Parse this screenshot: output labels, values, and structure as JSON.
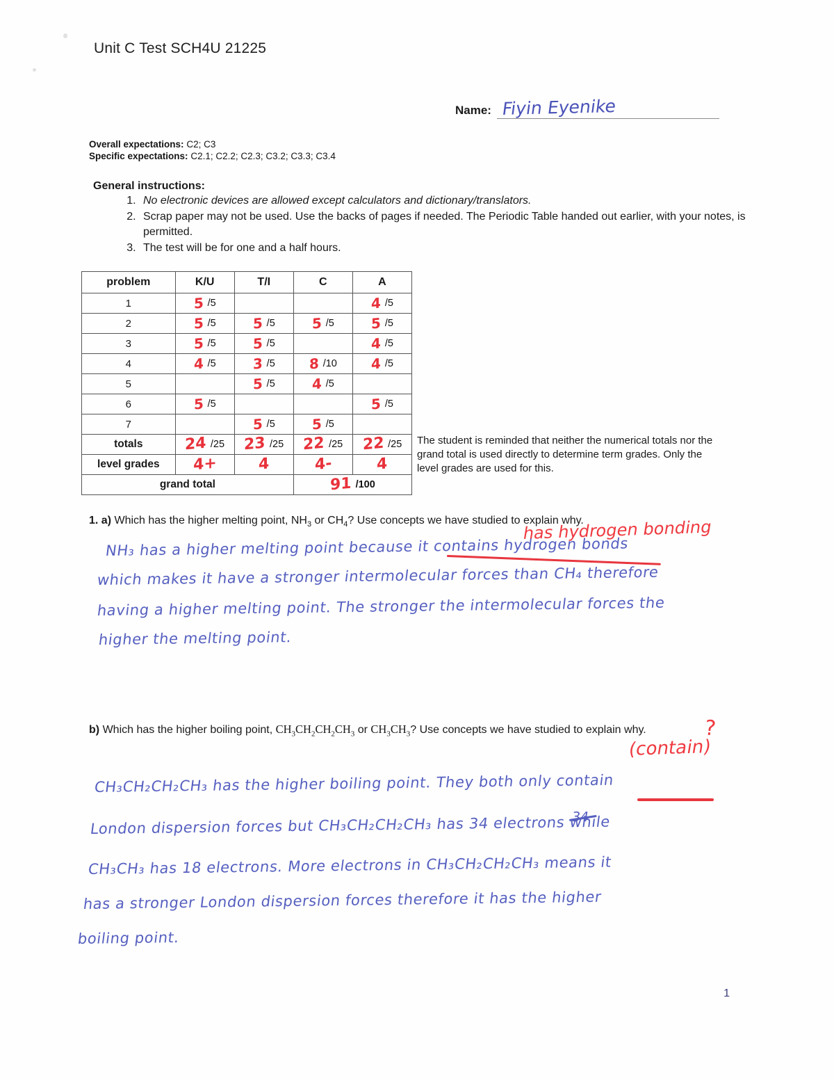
{
  "document": {
    "title": "Unit C Test SCH4U 21225",
    "page_number": "1"
  },
  "name_field": {
    "label": "Name:",
    "handwritten_value": "Fiyin Eyenike"
  },
  "expectations": {
    "overall_label": "Overall expectations:",
    "overall_value": "C2; C3",
    "specific_label": "Specific expectations:",
    "specific_value": "C2.1; C2.2; C2.3; C3.2; C3.3; C3.4"
  },
  "instructions": {
    "heading": "General instructions:",
    "items": [
      "No electronic devices are allowed except calculators and dictionary/translators.",
      "Scrap paper may not be used. Use the backs of pages if needed. The Periodic Table handed out earlier, with your notes, is permitted.",
      "The test will be for one and a half hours."
    ]
  },
  "grade_table": {
    "headers": [
      "problem",
      "K/U",
      "T/I",
      "C",
      "A"
    ],
    "rows": [
      {
        "problem": "1",
        "ku": {
          "mark": "5",
          "denom": "/5"
        },
        "ti": {
          "mark": "",
          "denom": ""
        },
        "c": {
          "mark": "",
          "denom": ""
        },
        "a": {
          "mark": "4",
          "denom": "/5"
        }
      },
      {
        "problem": "2",
        "ku": {
          "mark": "5",
          "denom": "/5"
        },
        "ti": {
          "mark": "5",
          "denom": "/5"
        },
        "c": {
          "mark": "5",
          "denom": "/5"
        },
        "a": {
          "mark": "5",
          "denom": "/5"
        }
      },
      {
        "problem": "3",
        "ku": {
          "mark": "5",
          "denom": "/5"
        },
        "ti": {
          "mark": "5",
          "denom": "/5"
        },
        "c": {
          "mark": "",
          "denom": ""
        },
        "a": {
          "mark": "4",
          "denom": "/5"
        }
      },
      {
        "problem": "4",
        "ku": {
          "mark": "4",
          "denom": "/5"
        },
        "ti": {
          "mark": "3",
          "denom": "/5"
        },
        "c": {
          "mark": "8",
          "denom": "/10"
        },
        "a": {
          "mark": "4",
          "denom": "/5"
        }
      },
      {
        "problem": "5",
        "ku": {
          "mark": "",
          "denom": ""
        },
        "ti": {
          "mark": "5",
          "denom": "/5"
        },
        "c": {
          "mark": "4",
          "denom": "/5"
        },
        "a": {
          "mark": "",
          "denom": ""
        }
      },
      {
        "problem": "6",
        "ku": {
          "mark": "5",
          "denom": "/5"
        },
        "ti": {
          "mark": "",
          "denom": ""
        },
        "c": {
          "mark": "",
          "denom": ""
        },
        "a": {
          "mark": "5",
          "denom": "/5"
        }
      },
      {
        "problem": "7",
        "ku": {
          "mark": "",
          "denom": ""
        },
        "ti": {
          "mark": "5",
          "denom": "/5"
        },
        "c": {
          "mark": "5",
          "denom": "/5"
        },
        "a": {
          "mark": "",
          "denom": ""
        }
      }
    ],
    "totals": {
      "label": "totals",
      "ku": {
        "mark": "24",
        "denom": "/25"
      },
      "ti": {
        "mark": "23",
        "denom": "/25"
      },
      "c": {
        "mark": "22",
        "denom": "/25"
      },
      "a": {
        "mark": "22",
        "denom": "/25"
      }
    },
    "level_grades": {
      "label": "level grades",
      "ku": "4+",
      "ti": "4",
      "c": "4-",
      "a": "4"
    },
    "grand_total": {
      "label": "grand total",
      "mark": "91",
      "denom": "/100"
    }
  },
  "table_note": "The student is reminded that neither the numerical totals nor the grand total is used directly to determine term grades. Only the level grades are used for this.",
  "questions": [
    {
      "number": "1. a)",
      "prompt_part1": "Which has the higher melting point, NH",
      "prompt_sub1": "3",
      "prompt_part2": " or CH",
      "prompt_sub2": "4",
      "prompt_part3": "? Use concepts we have studied to explain why.",
      "teacher_annotation": "has hydrogen bonding",
      "answer_lines": [
        "NH₃ has a higher melting point because it contains hydrogen bonds",
        "which makes it have a stronger intermolecular forces than CH₄ therefore",
        "having a higher melting point. The stronger the intermolecular forces the",
        "higher the melting point."
      ]
    },
    {
      "number": "b)",
      "prompt_part1": "Which has the higher boiling point, CH",
      "prompt_formula_a": "CH3CH2CH2CH3",
      "prompt_formula_b": "CH3CH3",
      "prompt_part3": "? Use concepts we have studied to explain why.",
      "teacher_annotation": "(contain)",
      "teacher_annotation_mark": "?",
      "answer_lines": [
        "CH₃CH₂CH₂CH₃ has the higher boiling point. They both only contain",
        "London dispersion forces but CH₃CH₂CH₂CH₃ has 34 electrons while",
        "CH₃CH₃ has 18 electrons. More electrons in CH₃CH₂CH₂CH₃ means it",
        "has a stronger London dispersion forces therefore it has the higher",
        "boiling point."
      ],
      "correction_above": "34"
    }
  ]
}
